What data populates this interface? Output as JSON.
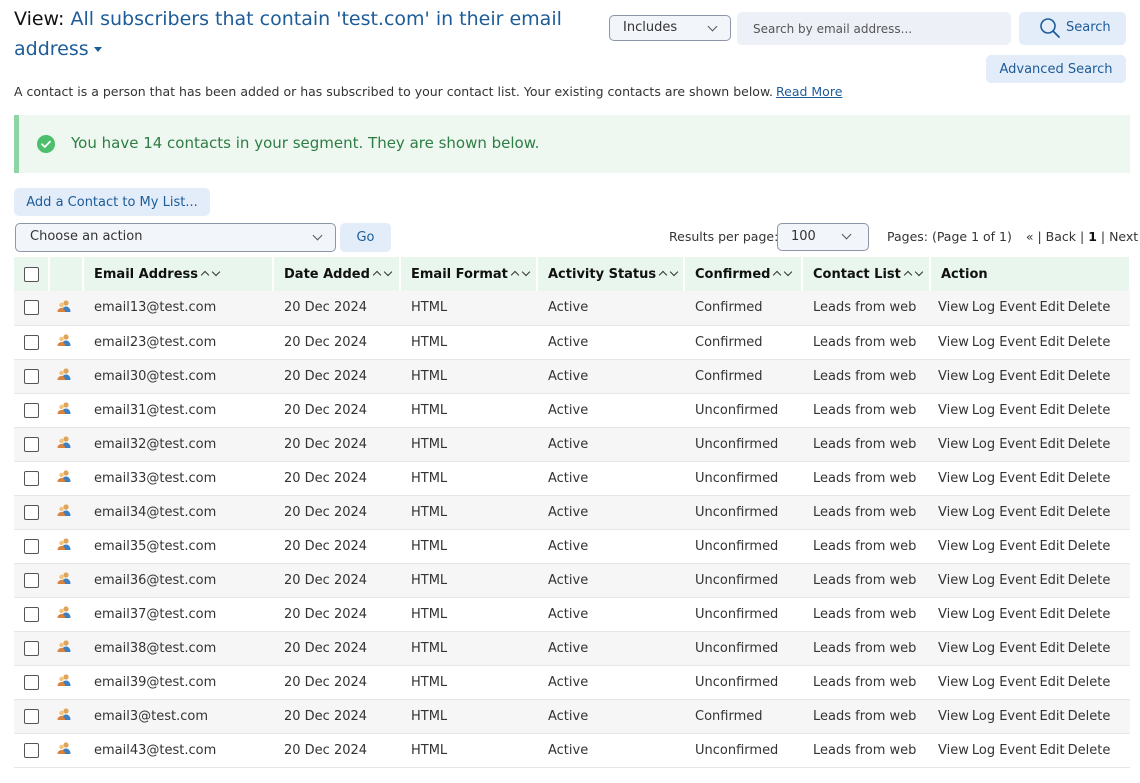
{
  "header": {
    "view_label": "View:",
    "view_name": "All subscribers that contain 'test.com' in their email address"
  },
  "search": {
    "filter_value": "Includes",
    "placeholder": "Search by email address...",
    "search_label": "Search",
    "advanced_label": "Advanced Search"
  },
  "intro": {
    "text": "A contact is a person that has been added or has subscribed to your contact list. Your existing contacts are shown below.",
    "read_more": "Read More"
  },
  "notice": {
    "message": "You have 14 contacts in your segment. They are shown below."
  },
  "toolbar": {
    "add_contact_label": "Add a Contact to My List...",
    "action_select_value": "Choose an action",
    "go_label": "Go",
    "results_per_page_label": "Results per page:",
    "results_per_page_value": "100"
  },
  "pager": {
    "pages_text": "Pages: (Page 1 of 1)",
    "first": "«",
    "back": "Back",
    "current": "1",
    "next": "Next",
    "last": "»"
  },
  "table": {
    "columns": [
      "Email Address",
      "Date Added",
      "Email Format",
      "Activity Status",
      "Confirmed",
      "Contact List",
      "Action"
    ],
    "actions": [
      "View",
      "Log Event",
      "Edit",
      "Delete"
    ],
    "rows": [
      {
        "email": "email13@test.com",
        "date": "20 Dec 2024",
        "format": "HTML",
        "status": "Active",
        "confirmed": "Confirmed",
        "list": "Leads from web"
      },
      {
        "email": "email23@test.com",
        "date": "20 Dec 2024",
        "format": "HTML",
        "status": "Active",
        "confirmed": "Confirmed",
        "list": "Leads from web"
      },
      {
        "email": "email30@test.com",
        "date": "20 Dec 2024",
        "format": "HTML",
        "status": "Active",
        "confirmed": "Confirmed",
        "list": "Leads from web"
      },
      {
        "email": "email31@test.com",
        "date": "20 Dec 2024",
        "format": "HTML",
        "status": "Active",
        "confirmed": "Unconfirmed",
        "list": "Leads from web"
      },
      {
        "email": "email32@test.com",
        "date": "20 Dec 2024",
        "format": "HTML",
        "status": "Active",
        "confirmed": "Unconfirmed",
        "list": "Leads from web"
      },
      {
        "email": "email33@test.com",
        "date": "20 Dec 2024",
        "format": "HTML",
        "status": "Active",
        "confirmed": "Unconfirmed",
        "list": "Leads from web"
      },
      {
        "email": "email34@test.com",
        "date": "20 Dec 2024",
        "format": "HTML",
        "status": "Active",
        "confirmed": "Unconfirmed",
        "list": "Leads from web"
      },
      {
        "email": "email35@test.com",
        "date": "20 Dec 2024",
        "format": "HTML",
        "status": "Active",
        "confirmed": "Unconfirmed",
        "list": "Leads from web"
      },
      {
        "email": "email36@test.com",
        "date": "20 Dec 2024",
        "format": "HTML",
        "status": "Active",
        "confirmed": "Unconfirmed",
        "list": "Leads from web"
      },
      {
        "email": "email37@test.com",
        "date": "20 Dec 2024",
        "format": "HTML",
        "status": "Active",
        "confirmed": "Unconfirmed",
        "list": "Leads from web"
      },
      {
        "email": "email38@test.com",
        "date": "20 Dec 2024",
        "format": "HTML",
        "status": "Active",
        "confirmed": "Unconfirmed",
        "list": "Leads from web"
      },
      {
        "email": "email39@test.com",
        "date": "20 Dec 2024",
        "format": "HTML",
        "status": "Active",
        "confirmed": "Unconfirmed",
        "list": "Leads from web"
      },
      {
        "email": "email3@test.com",
        "date": "20 Dec 2024",
        "format": "HTML",
        "status": "Active",
        "confirmed": "Confirmed",
        "list": "Leads from web"
      },
      {
        "email": "email43@test.com",
        "date": "20 Dec 2024",
        "format": "HTML",
        "status": "Active",
        "confirmed": "Unconfirmed",
        "list": "Leads from web"
      }
    ]
  },
  "icons": {
    "search": "search-icon",
    "success": "check-circle-icon",
    "contact": "user-icon",
    "dropdown": "chevron-down-icon"
  },
  "colors": {
    "link": "#1d5c99",
    "button_bg": "#e3ecf9",
    "notice_bg": "#eef8f0",
    "notice_text": "#2e7d45",
    "table_header_bg": "#e8f6ed"
  }
}
